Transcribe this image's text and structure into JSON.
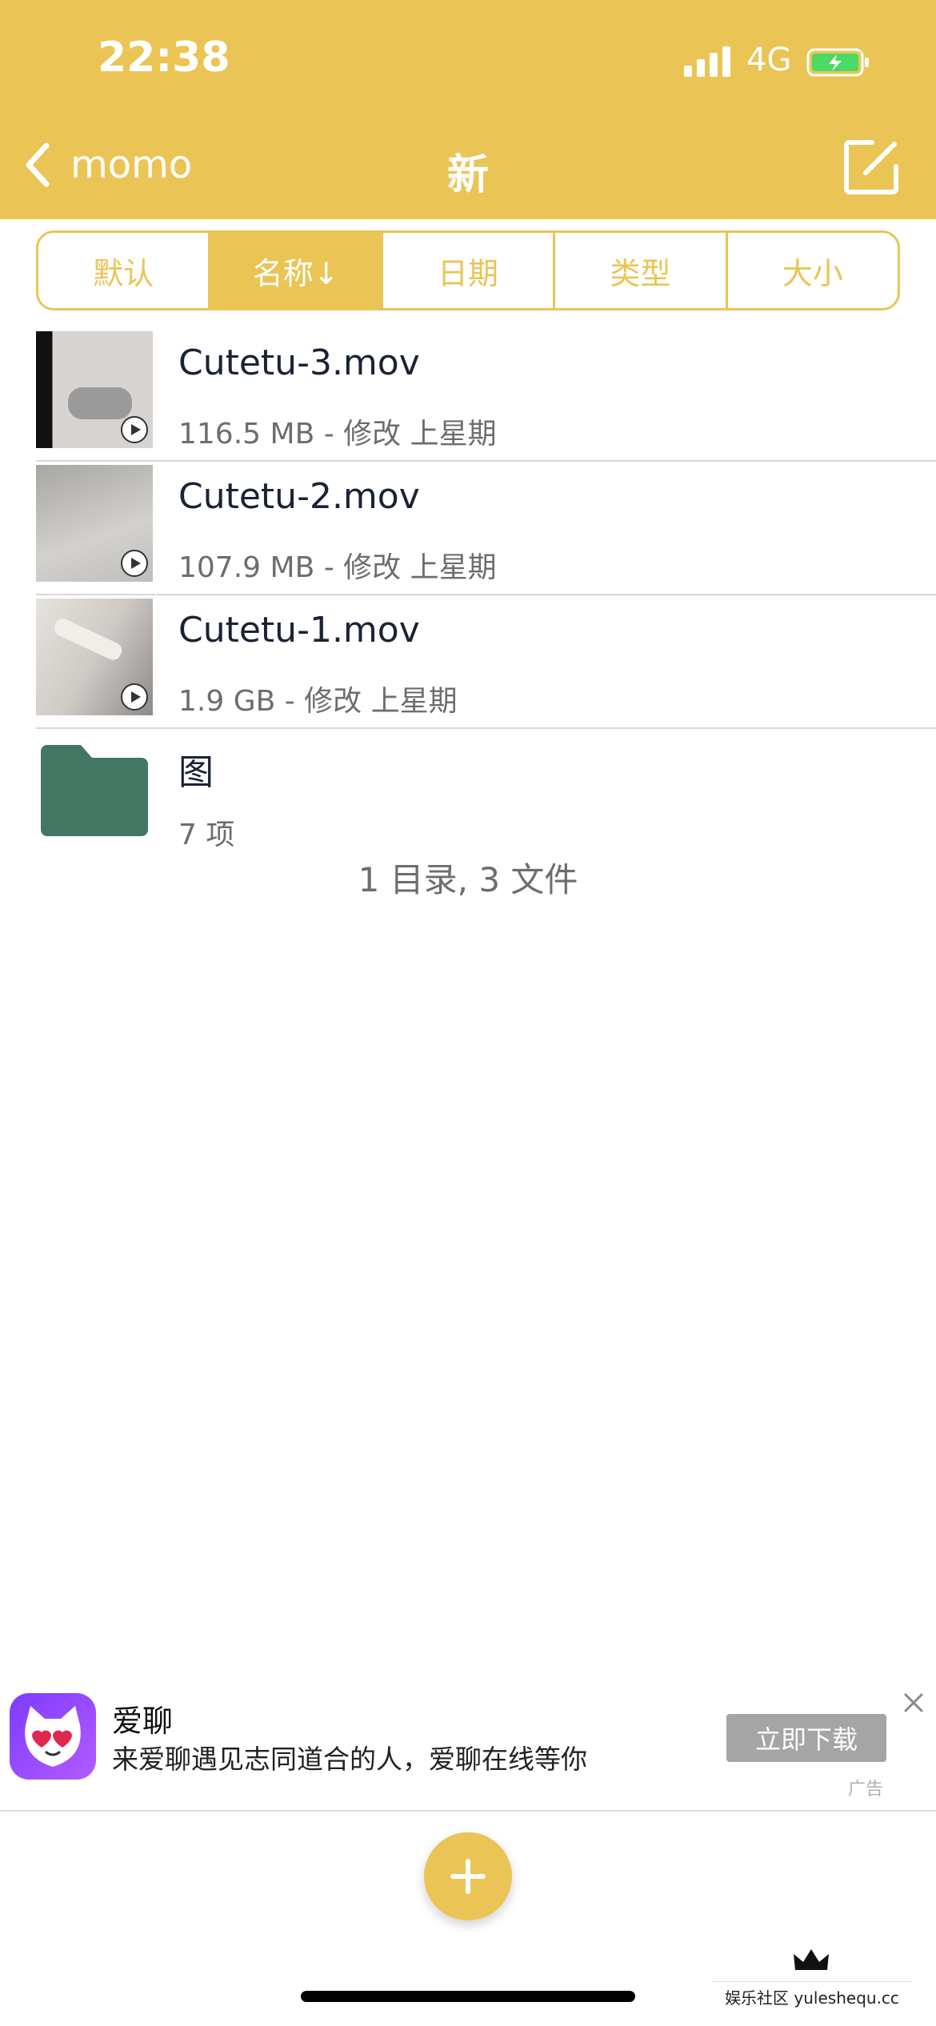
{
  "colors": {
    "accent": "#EAC555",
    "folder": "#447763"
  },
  "status_bar": {
    "time": "22:38",
    "network": "4G"
  },
  "nav": {
    "back_label": "momo",
    "title": "新"
  },
  "sort_segments": [
    {
      "label": "默认"
    },
    {
      "label": "名称↓"
    },
    {
      "label": "日期"
    },
    {
      "label": "类型"
    },
    {
      "label": "大小"
    }
  ],
  "files": [
    {
      "name": "Cutetu-3.mov",
      "meta": "116.5 MB - 修改 上星期"
    },
    {
      "name": "Cutetu-2.mov",
      "meta": "107.9 MB - 修改 上星期"
    },
    {
      "name": "Cutetu-1.mov",
      "meta": "1.9 GB - 修改 上星期"
    },
    {
      "name": "图",
      "meta": "7 项"
    }
  ],
  "summary": "1 目录, 3 文件",
  "ad": {
    "title": "爱聊",
    "description": "来爱聊遇见志同道合的人，爱聊在线等你",
    "button": "立即下载",
    "tag": "广告"
  },
  "watermark": "娱乐社区 yuleshequ.cc"
}
